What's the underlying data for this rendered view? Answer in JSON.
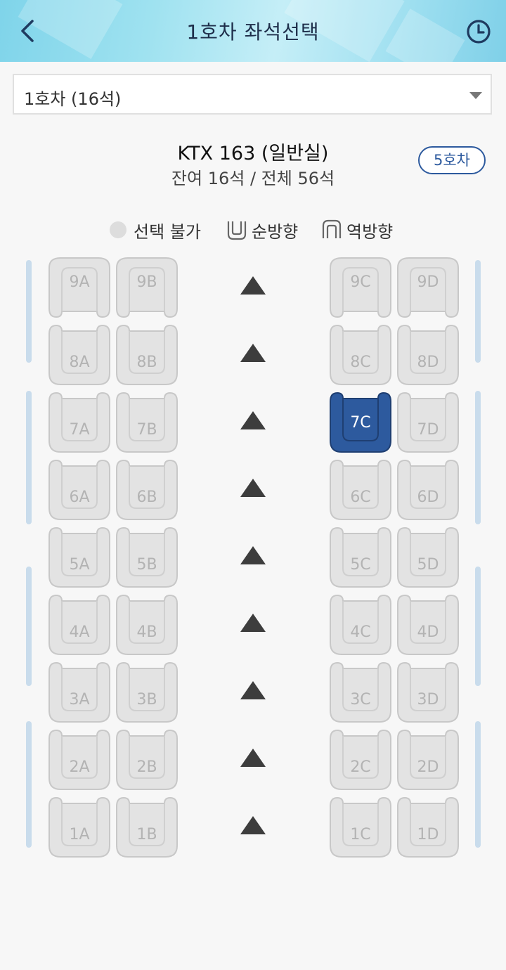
{
  "header": {
    "title": "1호차 좌석선택",
    "back_icon": "chevron-left-icon",
    "history_icon": "clock-icon"
  },
  "car_select": {
    "value": "1호차 (16석)"
  },
  "train": {
    "name": "KTX 163 (일반실)",
    "seat_info": "잔여 16석 / 전체 56석",
    "next_car": "5호차"
  },
  "legend": {
    "unavailable": "선택 불가",
    "forward": "순방향",
    "reverse": "역방향"
  },
  "colors": {
    "selected": "#2d5a9e",
    "unavailable_fill": "#e3e3e3",
    "unavailable_stroke": "#c8c8c8",
    "wall": "#c9dcec",
    "accent": "#2d5a9e"
  },
  "rows": [
    {
      "seats": [
        {
          "id": "9A",
          "orientation": "reverse",
          "state": "unavailable"
        },
        {
          "id": "9B",
          "orientation": "reverse",
          "state": "unavailable"
        },
        {
          "id": "9C",
          "orientation": "reverse",
          "state": "unavailable"
        },
        {
          "id": "9D",
          "orientation": "reverse",
          "state": "unavailable"
        }
      ]
    },
    {
      "seats": [
        {
          "id": "8A",
          "orientation": "forward",
          "state": "unavailable"
        },
        {
          "id": "8B",
          "orientation": "forward",
          "state": "unavailable"
        },
        {
          "id": "8C",
          "orientation": "forward",
          "state": "unavailable"
        },
        {
          "id": "8D",
          "orientation": "forward",
          "state": "unavailable"
        }
      ]
    },
    {
      "seats": [
        {
          "id": "7A",
          "orientation": "forward",
          "state": "unavailable"
        },
        {
          "id": "7B",
          "orientation": "forward",
          "state": "unavailable"
        },
        {
          "id": "7C",
          "orientation": "forward",
          "state": "selected"
        },
        {
          "id": "7D",
          "orientation": "forward",
          "state": "unavailable"
        }
      ]
    },
    {
      "seats": [
        {
          "id": "6A",
          "orientation": "forward",
          "state": "unavailable"
        },
        {
          "id": "6B",
          "orientation": "forward",
          "state": "unavailable"
        },
        {
          "id": "6C",
          "orientation": "forward",
          "state": "unavailable"
        },
        {
          "id": "6D",
          "orientation": "forward",
          "state": "unavailable"
        }
      ]
    },
    {
      "seats": [
        {
          "id": "5A",
          "orientation": "forward",
          "state": "unavailable"
        },
        {
          "id": "5B",
          "orientation": "forward",
          "state": "unavailable"
        },
        {
          "id": "5C",
          "orientation": "forward",
          "state": "unavailable"
        },
        {
          "id": "5D",
          "orientation": "forward",
          "state": "unavailable"
        }
      ]
    },
    {
      "seats": [
        {
          "id": "4A",
          "orientation": "forward",
          "state": "unavailable"
        },
        {
          "id": "4B",
          "orientation": "forward",
          "state": "unavailable"
        },
        {
          "id": "4C",
          "orientation": "forward",
          "state": "unavailable"
        },
        {
          "id": "4D",
          "orientation": "forward",
          "state": "unavailable"
        }
      ]
    },
    {
      "seats": [
        {
          "id": "3A",
          "orientation": "forward",
          "state": "unavailable"
        },
        {
          "id": "3B",
          "orientation": "forward",
          "state": "unavailable"
        },
        {
          "id": "3C",
          "orientation": "forward",
          "state": "unavailable"
        },
        {
          "id": "3D",
          "orientation": "forward",
          "state": "unavailable"
        }
      ]
    },
    {
      "seats": [
        {
          "id": "2A",
          "orientation": "forward",
          "state": "unavailable"
        },
        {
          "id": "2B",
          "orientation": "forward",
          "state": "unavailable"
        },
        {
          "id": "2C",
          "orientation": "forward",
          "state": "unavailable"
        },
        {
          "id": "2D",
          "orientation": "forward",
          "state": "unavailable"
        }
      ]
    },
    {
      "seats": [
        {
          "id": "1A",
          "orientation": "forward",
          "state": "unavailable"
        },
        {
          "id": "1B",
          "orientation": "forward",
          "state": "unavailable"
        },
        {
          "id": "1C",
          "orientation": "forward",
          "state": "unavailable"
        },
        {
          "id": "1D",
          "orientation": "forward",
          "state": "unavailable"
        }
      ]
    }
  ]
}
